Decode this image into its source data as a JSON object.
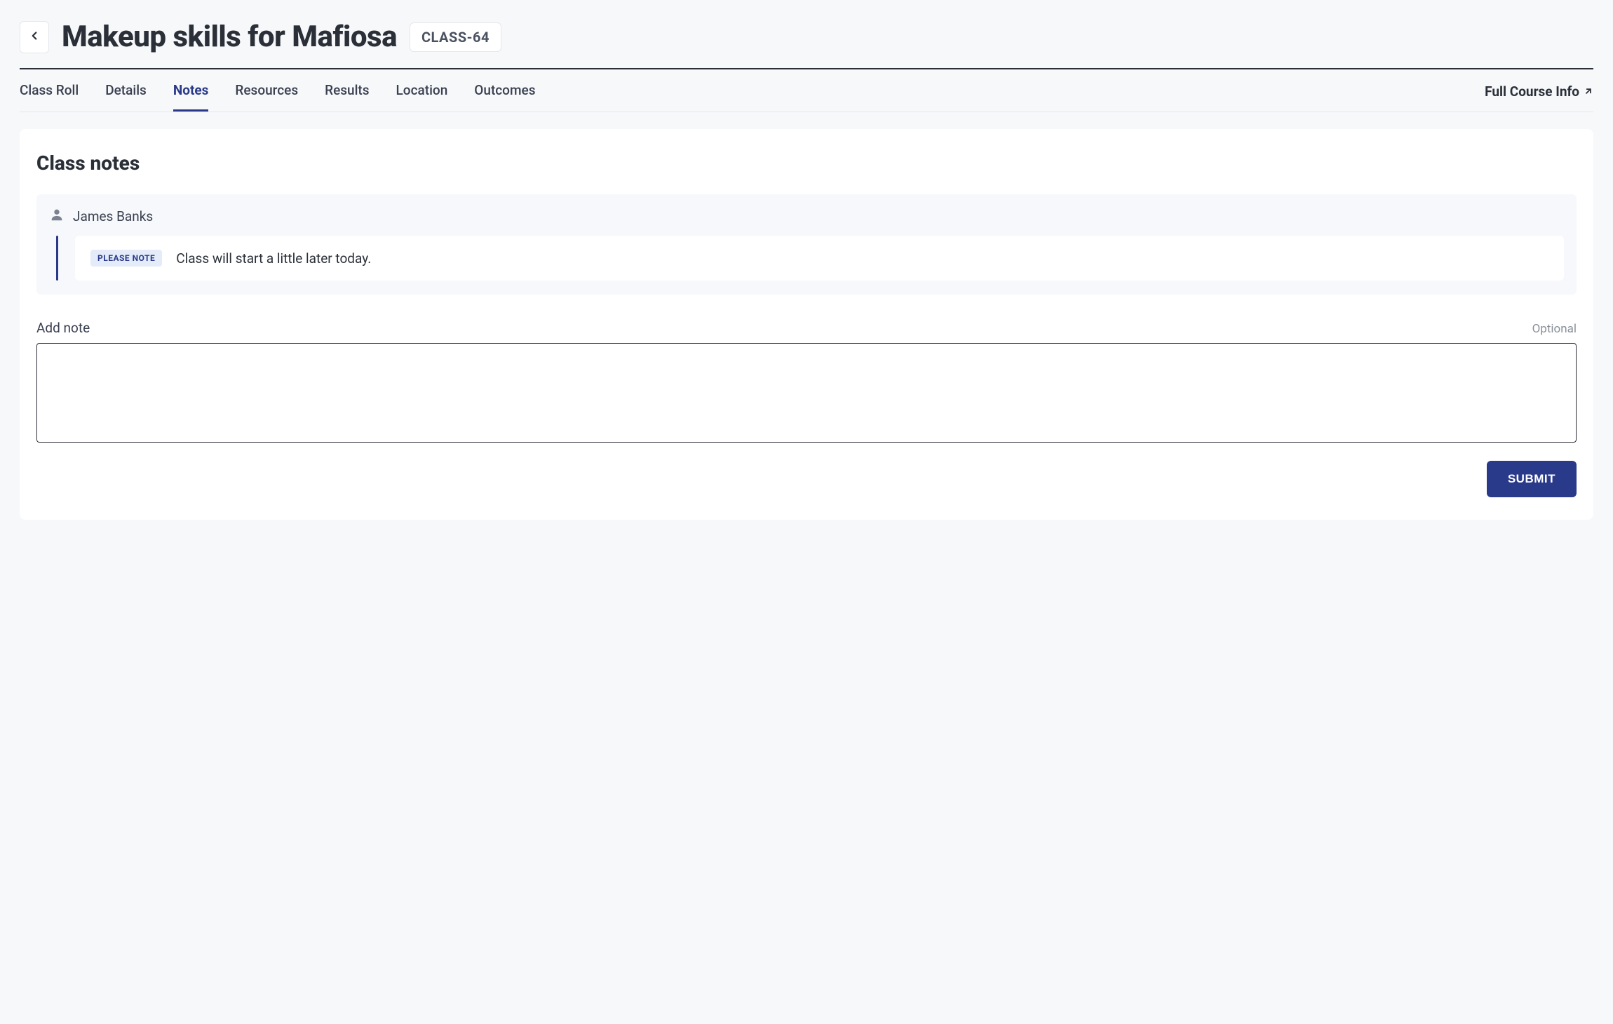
{
  "header": {
    "title": "Makeup skills for Mafiosa",
    "class_code": "CLASS-64"
  },
  "tabs": [
    {
      "label": "Class Roll",
      "active": false
    },
    {
      "label": "Details",
      "active": false
    },
    {
      "label": "Notes",
      "active": true
    },
    {
      "label": "Resources",
      "active": false
    },
    {
      "label": "Results",
      "active": false
    },
    {
      "label": "Location",
      "active": false
    },
    {
      "label": "Outcomes",
      "active": false
    }
  ],
  "full_course_link": "Full Course Info",
  "notes_section": {
    "heading": "Class notes",
    "note": {
      "author": "James Banks",
      "tag": "PLEASE NOTE",
      "text": "Class will start a little later today."
    }
  },
  "add_note": {
    "label": "Add note",
    "optional": "Optional",
    "value": "",
    "submit": "SUBMIT"
  }
}
